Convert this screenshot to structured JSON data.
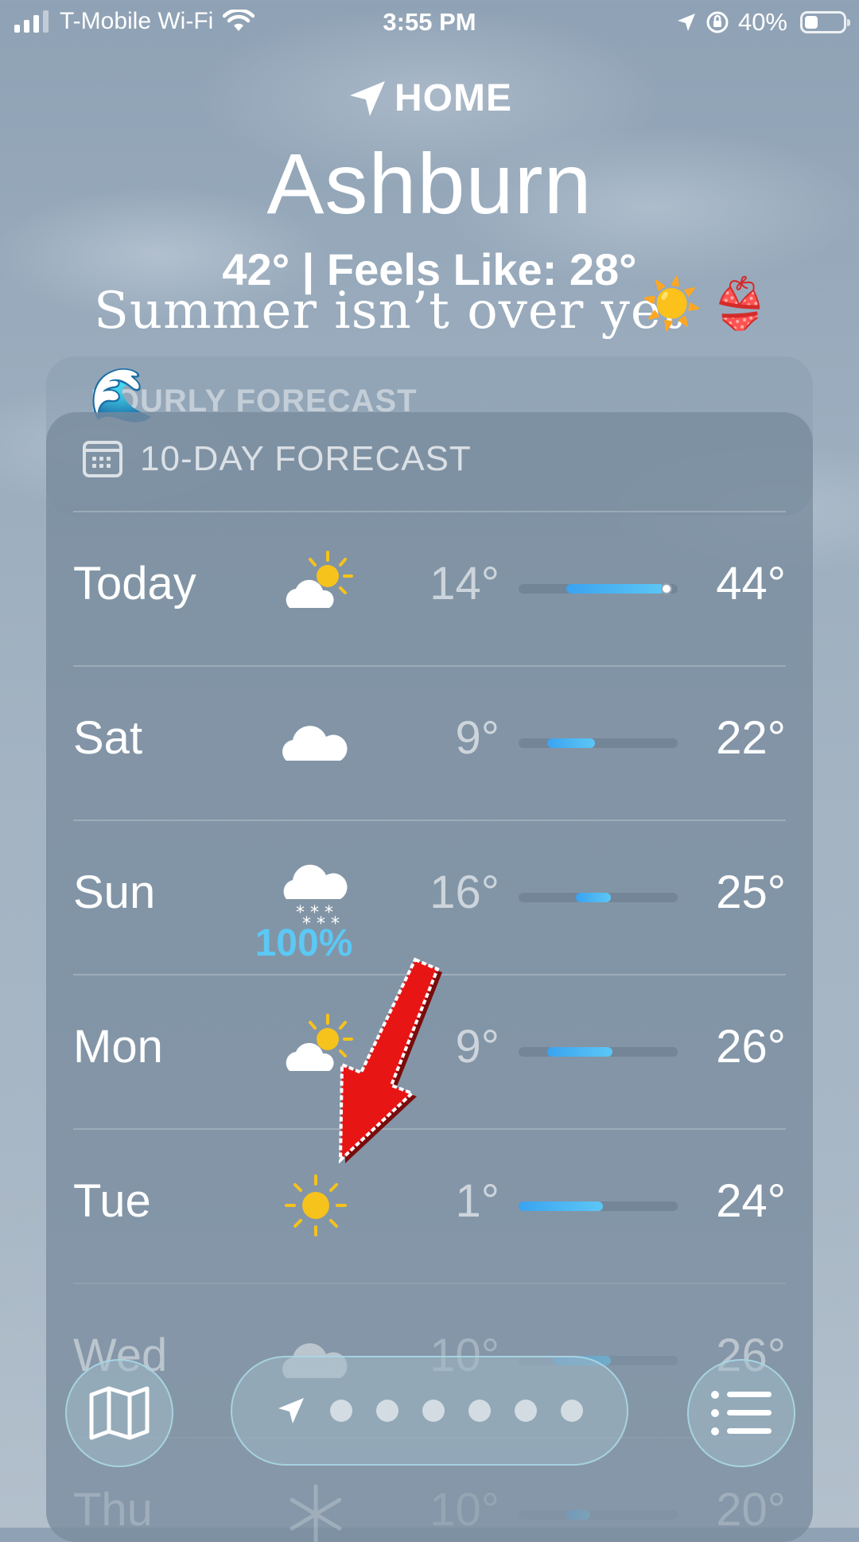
{
  "status_bar": {
    "carrier": "T-Mobile Wi-Fi",
    "time": "3:55 PM",
    "battery": "40%",
    "battery_level": 0.4
  },
  "header": {
    "home_label": "HOME",
    "city": "Ashburn",
    "conditions": "42° | Feels Like: 28°"
  },
  "overlay": {
    "text": "Summer isn’t over yet",
    "emoji_sun": "☀️",
    "emoji_bikini": "👙",
    "emoji_wave": "🌊"
  },
  "hourly_card": {
    "title": "HOURLY FORECAST"
  },
  "forecast": {
    "title": "10-DAY FORECAST",
    "days": [
      {
        "day": "Today",
        "icon": "partly-sunny-icon",
        "precip": "",
        "low": "14°",
        "high": "44°",
        "bar_start": 0.3,
        "bar_end": 0.92,
        "current": 0.93
      },
      {
        "day": "Sat",
        "icon": "cloud-icon",
        "precip": "",
        "low": "9°",
        "high": "22°",
        "bar_start": 0.18,
        "bar_end": 0.48
      },
      {
        "day": "Sun",
        "icon": "snow-icon",
        "precip": "100%",
        "low": "16°",
        "high": "25°",
        "bar_start": 0.36,
        "bar_end": 0.58
      },
      {
        "day": "Mon",
        "icon": "partly-sunny-icon",
        "precip": "",
        "low": "9°",
        "high": "26°",
        "bar_start": 0.18,
        "bar_end": 0.59
      },
      {
        "day": "Tue",
        "icon": "sun-icon",
        "precip": "",
        "low": "1°",
        "high": "24°",
        "bar_start": 0.0,
        "bar_end": 0.53
      },
      {
        "day": "Wed",
        "icon": "cloud-icon",
        "precip": "",
        "low": "10°",
        "high": "26°",
        "bar_start": 0.22,
        "bar_end": 0.58
      },
      {
        "day": "Thu",
        "icon": "snowflake-icon",
        "precip": "",
        "low": "10°",
        "high": "20°",
        "bar_start": 0.3,
        "bar_end": 0.45
      }
    ]
  },
  "toolbar": {
    "page_count": 6
  }
}
